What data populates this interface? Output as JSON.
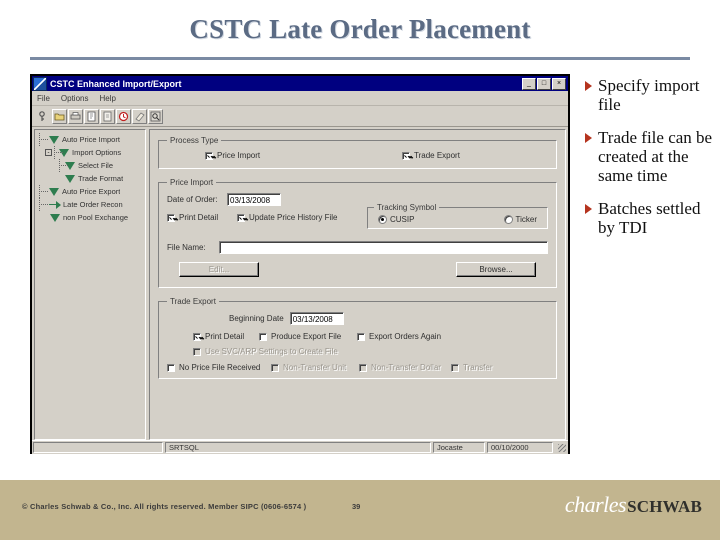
{
  "slide": {
    "title": "CSTC Late Order Placement"
  },
  "window": {
    "title": "CSTC Enhanced Import/Export",
    "icon": "app-icon",
    "controls": {
      "minimize": "_",
      "maximize": "□",
      "close": "×"
    },
    "menus": [
      {
        "label": "File",
        "accel": "F"
      },
      {
        "label": "Options",
        "accel": "O"
      },
      {
        "label": "Help",
        "accel": "H"
      }
    ],
    "toolbar": [
      {
        "name": "key-icon"
      },
      {
        "name": "folder-open-icon"
      },
      {
        "name": "printer-icon"
      },
      {
        "name": "print-preview-icon"
      },
      {
        "name": "document-icon"
      },
      {
        "name": "clock-red-icon"
      },
      {
        "name": "eraser-icon"
      },
      {
        "name": "search-window-icon"
      }
    ],
    "tree": [
      {
        "label": "Auto Price Import",
        "indent": 0,
        "expander": "-",
        "icon": "triangle"
      },
      {
        "label": "Import Options",
        "indent": 1,
        "expander": "-",
        "icon": "triangle"
      },
      {
        "label": "Select File",
        "indent": 2,
        "expander": "",
        "icon": "triangle"
      },
      {
        "label": "Trade Format",
        "indent": 2,
        "expander": "",
        "icon": "triangle"
      },
      {
        "label": "Auto Price Export",
        "indent": 0,
        "expander": "",
        "icon": "triangle"
      },
      {
        "label": "Late Order Recon",
        "indent": 0,
        "expander": "",
        "icon": "arrow"
      },
      {
        "label": "non Pool Exchange",
        "indent": 0,
        "expander": "",
        "icon": "triangle"
      }
    ],
    "process_type": {
      "legend": "Process Type",
      "price_import": {
        "label": "Price Import",
        "checked": true
      },
      "trade_export": {
        "label": "Trade Export",
        "checked": true
      }
    },
    "price_import": {
      "legend": "Price Import",
      "date_label": "Date of Order:",
      "date_value": "03/13/2008",
      "print_detail": {
        "label": "Print Detail",
        "checked": true
      },
      "update_history": {
        "label": "Update Price History File",
        "checked": true
      },
      "tracking": {
        "legend": "Tracking Symbol",
        "options": [
          {
            "label": "CUSIP",
            "selected": true
          },
          {
            "label": "Ticker",
            "selected": false
          }
        ]
      },
      "file_name_label": "File Name:",
      "file_name_value": "",
      "edit_button": {
        "label": "Edit...",
        "disabled": true
      },
      "browse_button": {
        "label": "Browse...",
        "disabled": false
      }
    },
    "trade_export": {
      "legend": "Trade Export",
      "beginning_date_label": "Beginning Date",
      "beginning_date_value": "03/13/2008",
      "print_detail": {
        "label": "Print Detail",
        "checked": true,
        "disabled": false
      },
      "produce_export_file": {
        "label": "Produce Export File",
        "checked": false,
        "disabled": false
      },
      "export_orders_again": {
        "label": "Export Orders Again",
        "checked": false,
        "disabled": false
      },
      "use_svc_arp": {
        "label": "Use SVC/ARP Settings to Create File",
        "checked": false,
        "disabled": true
      },
      "no_price_file": {
        "label": "No Price File Received",
        "checked": false,
        "disabled": false
      },
      "non_transfer_unit": {
        "label": "Non-Transfer Unit",
        "checked": false,
        "disabled": true
      },
      "non_transfer_dollar": {
        "label": "Non-Transfer Dollar",
        "checked": false,
        "disabled": true
      },
      "transfer": {
        "label": "Transfer",
        "checked": false,
        "disabled": true
      }
    },
    "statusbar": {
      "left": "",
      "database": "SRTSQL",
      "user": "Jocaste",
      "date": "00/10/2000"
    }
  },
  "bullets": [
    {
      "text": "Specify import file"
    },
    {
      "text": "Trade file can be created at the same time"
    },
    {
      "text": "Batches settled by TDI"
    }
  ],
  "footer": {
    "copyright": "© Charles Schwab & Co., Inc.  All rights reserved.  Member SIPC  (0606-6574 )",
    "page_number": "39",
    "logo_first": "charles",
    "logo_second": "SCHWAB"
  },
  "colors": {
    "title": "#5b6b84",
    "bullet_mark": "#b5341f",
    "titlebar": "#000080",
    "window_face": "#d4d0c8",
    "footer_bg": "#c2b58f"
  }
}
